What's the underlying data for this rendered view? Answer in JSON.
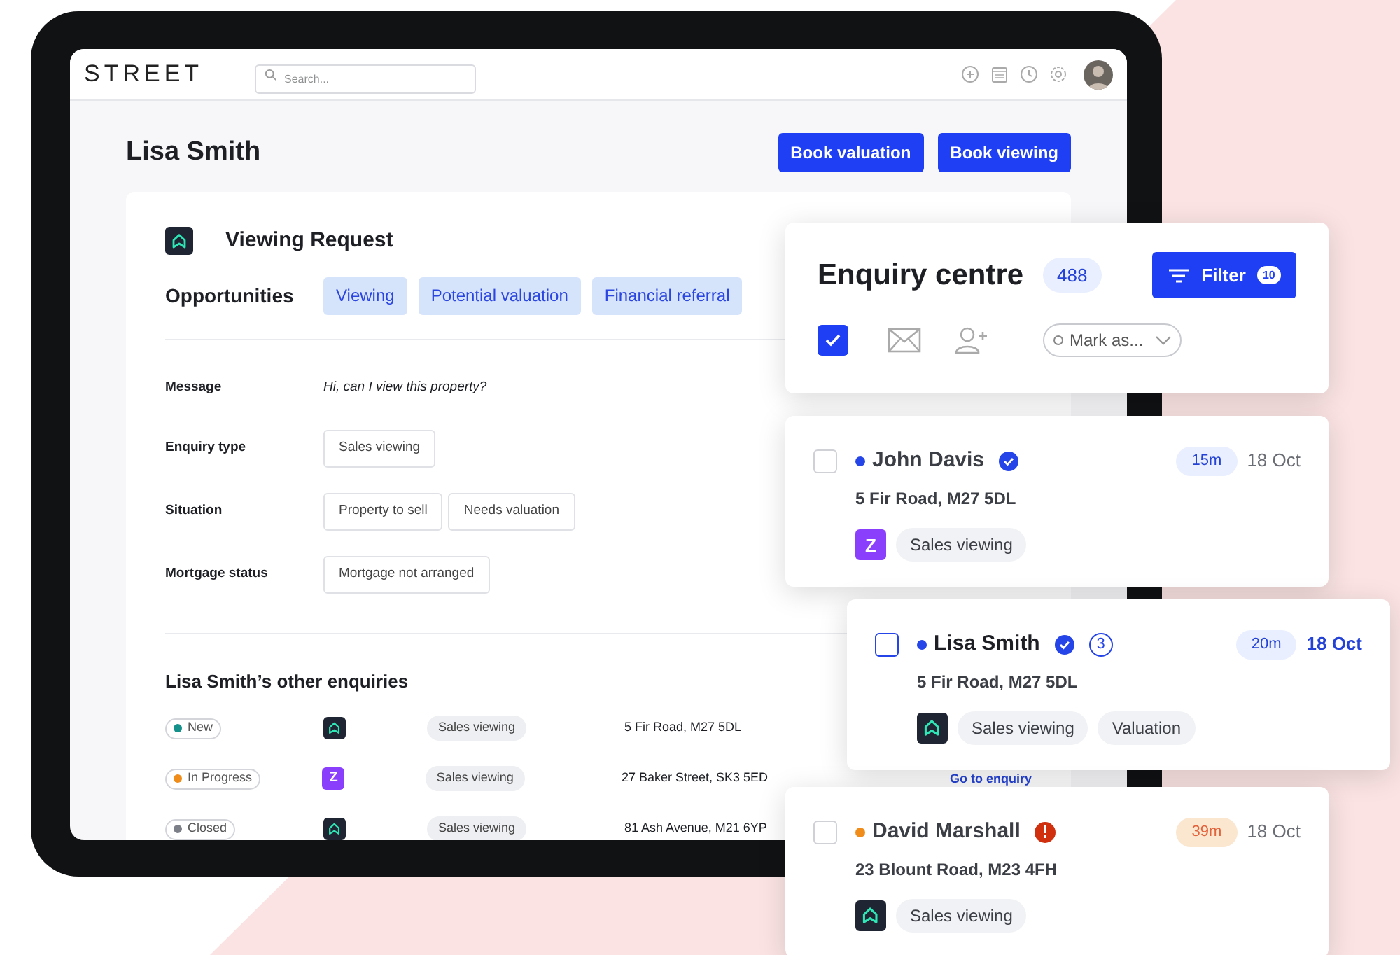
{
  "app": {
    "logo": "STREET",
    "search": {
      "placeholder": "Search..."
    },
    "page_title": "Lisa Smith",
    "buttons": [
      "Book valuation",
      "Book viewing"
    ]
  },
  "request": {
    "source": {
      "kind": "house"
    },
    "title": "Viewing Request",
    "opportunities_label": "Opportunities",
    "opportunities": [
      "Viewing",
      "Potential valuation",
      "Financial referral"
    ],
    "fields": [
      {
        "label": "Message",
        "kind": "text",
        "value": "Hi, can I view this property?"
      },
      {
        "label": "Enquiry type",
        "kind": "chips",
        "values": [
          "Sales viewing"
        ]
      },
      {
        "label": "Situation",
        "kind": "chips",
        "values": [
          "Property to sell",
          "Needs valuation"
        ]
      },
      {
        "label": "Mortgage status",
        "kind": "chips",
        "values": [
          "Mortgage not arranged"
        ]
      }
    ]
  },
  "other_enquiries": {
    "title": "Lisa Smith’s other enquiries",
    "rows": [
      {
        "status": "New",
        "color": "#14918a",
        "source": {
          "kind": "house"
        },
        "type": "Sales viewing",
        "address": "5 Fir Road, M27 5DL"
      },
      {
        "status": "In Progress",
        "color": "#f08c1a",
        "source": {
          "kind": "portal",
          "mark": "Z"
        },
        "type": "Sales viewing",
        "address": "27 Baker Street, SK3 5ED",
        "link": "Go to enquiry"
      },
      {
        "status": "Closed",
        "color": "#7c7f88",
        "source": {
          "kind": "house"
        },
        "type": "Sales viewing",
        "address": "81 Ash Avenue, M21 6YP"
      }
    ]
  },
  "enquiry_centre": {
    "title": "Enquiry centre",
    "count": "488",
    "filter": {
      "label": "Filter",
      "count": "10"
    },
    "select_all_checked": true,
    "mark_as": "Mark as..."
  },
  "enquiries": [
    {
      "name": "John Davis",
      "color": "#2545e8",
      "selected": false,
      "verified": true,
      "alert": false,
      "time": "15m",
      "overdue": false,
      "date": "18 Oct",
      "address": "5 Fir Road, M27 5DL",
      "source": {
        "kind": "portal",
        "mark": "Z"
      },
      "tags": [
        "Sales viewing"
      ]
    },
    {
      "name": "Lisa Smith",
      "color": "#2545e8",
      "selected": true,
      "verified": true,
      "alert": false,
      "count": "3",
      "time": "20m",
      "overdue": false,
      "date": "18 Oct",
      "address": "5 Fir Road, M27 5DL",
      "source": {
        "kind": "house"
      },
      "tags": [
        "Sales viewing",
        "Valuation"
      ]
    },
    {
      "name": "David Marshall",
      "color": "#f08c1a",
      "selected": false,
      "verified": false,
      "alert": true,
      "time": "39m",
      "overdue": true,
      "date": "18 Oct",
      "address": "23 Blount Road, M23 4FH",
      "source": {
        "kind": "house"
      },
      "tags": [
        "Sales viewing"
      ]
    }
  ]
}
